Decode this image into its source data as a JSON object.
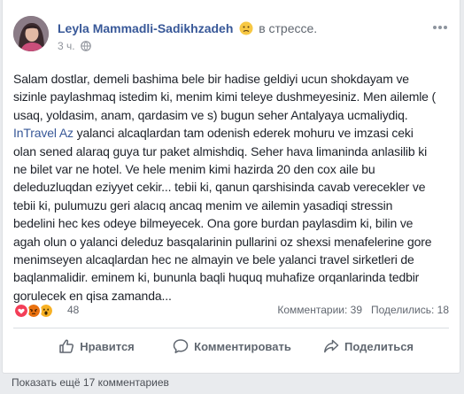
{
  "post": {
    "author": "Leyla Mammadli-Sadikhzadeh",
    "feeling": "в стрессе.",
    "time": "3 ч.",
    "text_lines": [
      "Salam dostlar, demeli bashima bele bir hadise geldiyi ucun shokdayam ve",
      "sizinle paylashmaq istedim ki, menim kimi teleye dushmeyesiniz. Men ailemle (",
      "usaq, yoldasim, anam, qardasim ve s) bugun seher Antalyaya ucmaliydiq.",
      "yalanci alcaqlardan tam odenish ederek mohuru ve imzasi ceki",
      "olan sened alaraq guya tur paket almishdiq. Seher hava limaninda anlasilib ki",
      "ne bilet var ne hotel. Ve hele menim kimi hazirda 20 den cox aile bu",
      "deleduzluqdan eziyyet cekir... tebii ki, qanun qarshisinda cavab verecekler ve",
      "tebii ki, pulumuzu geri alacıq ancaq menim ve ailemin yasadiqi stressin",
      "bedelini hec kes odeye bilmeyecek. Ona gore burdan paylasdim ki, bilin ve",
      "agah olun o yalanci deleduz basqalarinin pullarini oz shexsi menafelerine gore",
      "menimseyen alcaqlardan hec ne almayin ve bele yalanci travel sirketleri de",
      "baqlanmalidir. eminem ki, bununla baqli huquq muhafize orqanlarinda tedbir",
      "gorulecek en qisa zamanda..."
    ],
    "mention": "InTravel Az"
  },
  "stats": {
    "reactions_count": "48",
    "comments": "Комментарии: 39",
    "shares": "Поделились: 18"
  },
  "actions": {
    "like": "Нравится",
    "comment": "Комментировать",
    "share": "Поделиться"
  },
  "more_comments": "Показать ещё 17 комментариев",
  "colors": {
    "link": "#385898",
    "love": "#f33e58",
    "angry": "#e9710f",
    "wow": "#f7b125"
  }
}
